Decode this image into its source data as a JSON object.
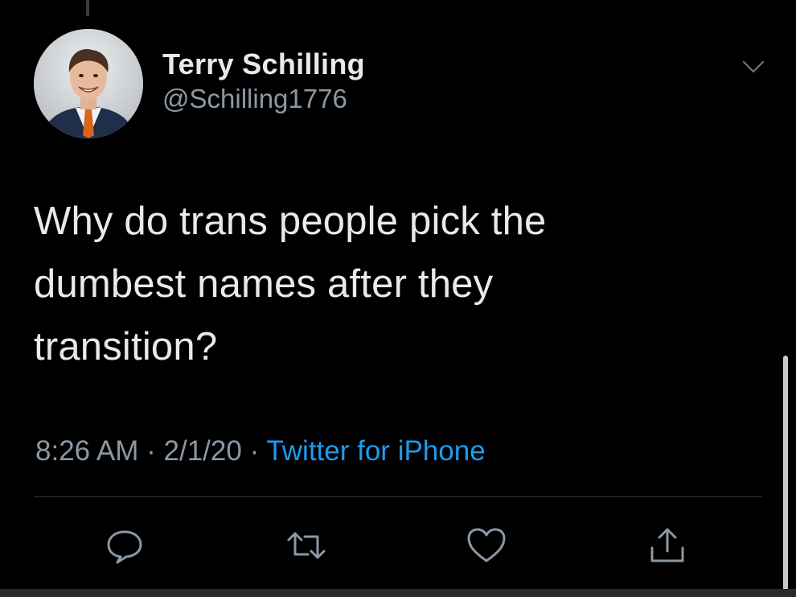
{
  "author": {
    "display_name": "Terry Schilling",
    "handle": "@Schilling1776"
  },
  "tweet": {
    "text_line_1": "Why do trans people pick the",
    "text_line_2": "dumbest names after they",
    "text_line_3": "transition?"
  },
  "meta": {
    "time": "8:26 AM",
    "separator_1": " · ",
    "date": "2/1/20",
    "separator_2": " · ",
    "source": "Twitter for iPhone"
  },
  "icons": {
    "more": "chevron-down-icon",
    "reply": "reply-icon",
    "retweet": "retweet-icon",
    "like": "heart-icon",
    "share": "share-icon"
  },
  "colors": {
    "background": "#000000",
    "text_primary": "#e7e9ea",
    "text_secondary": "#8b98a5",
    "link_blue": "#1d9bf0",
    "divider": "#2f3336"
  }
}
